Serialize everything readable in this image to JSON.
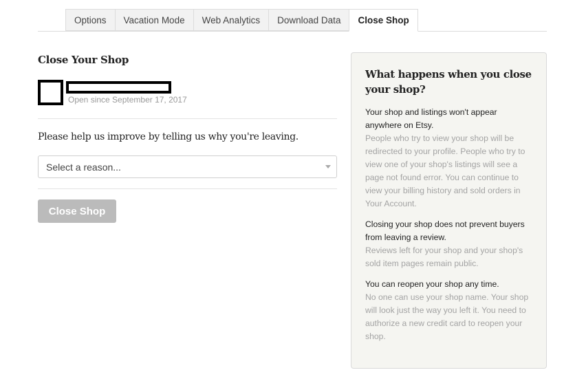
{
  "tabs": [
    {
      "label": "Options",
      "active": false
    },
    {
      "label": "Vacation Mode",
      "active": false
    },
    {
      "label": "Web Analytics",
      "active": false
    },
    {
      "label": "Download Data",
      "active": false
    },
    {
      "label": "Close Shop",
      "active": true
    }
  ],
  "main": {
    "title": "Close Your Shop",
    "shop": {
      "open_since": "Open since September 17, 2017"
    },
    "question": "Please help us improve by telling us why you're leaving.",
    "reason_select": {
      "placeholder": "Select a reason..."
    },
    "close_button_label": "Close Shop"
  },
  "info_panel": {
    "title": "What happens when you close your shop?",
    "sections": [
      {
        "heading": "Your shop and listings won't appear anywhere on Etsy.",
        "body": "People who try to view your shop will be redirected to your profile. People who try to view one of your shop's listings will see a page not found error. You can continue to view your billing history and sold orders in Your Account."
      },
      {
        "heading": "Closing your shop does not prevent buyers from leaving a review.",
        "body": "Reviews left for your shop and your shop's sold item pages remain public."
      },
      {
        "heading": "You can reopen your shop any time.",
        "body": "No one can use your shop name. Your shop will look just the way you left it. You need to authorize a new credit card to reopen your shop."
      }
    ]
  }
}
